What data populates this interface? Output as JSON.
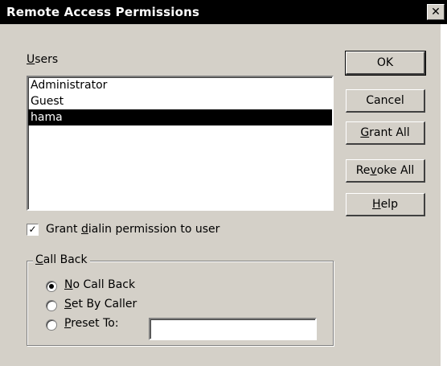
{
  "dialog": {
    "title": "Remote Access Permissions",
    "close_glyph": "✕"
  },
  "users": {
    "label_mnemonic": "U",
    "label_rest": "sers",
    "items": [
      "Administrator",
      "Guest",
      "hama"
    ],
    "selected": "hama"
  },
  "buttons": {
    "ok": "OK",
    "cancel": "Cancel",
    "grant_all_mnemonic": "G",
    "grant_all_rest": "rant All",
    "revoke_all_pre": "Re",
    "revoke_all_mnemonic": "v",
    "revoke_all_rest": "oke All",
    "help_mnemonic": "H",
    "help_rest": "elp"
  },
  "dialin": {
    "checked": true,
    "check_glyph": "✓",
    "label_pre": "Grant ",
    "label_mnemonic": "d",
    "label_rest": "ialin permission to user"
  },
  "callback": {
    "group_mnemonic": "C",
    "group_rest": "all Back",
    "selected": "no_call_back",
    "options": {
      "no_call_back": {
        "mnemonic": "N",
        "rest": "o Call Back"
      },
      "set_by_caller": {
        "mnemonic": "S",
        "rest": "et By Caller"
      },
      "preset_to": {
        "mnemonic": "P",
        "rest": "reset To:"
      }
    },
    "preset_value": ""
  }
}
